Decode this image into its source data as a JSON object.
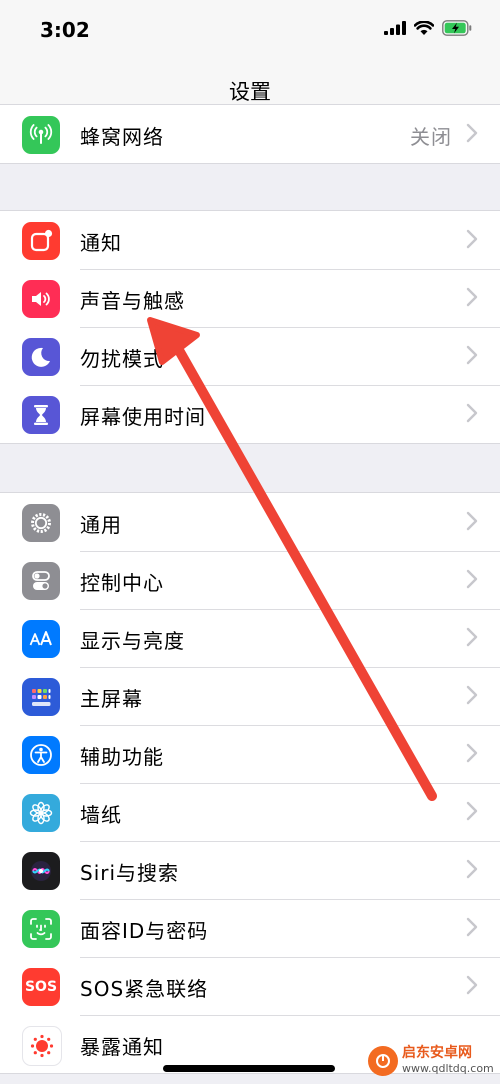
{
  "status": {
    "time": "3:02"
  },
  "nav": {
    "title": "设置"
  },
  "group_top": [
    {
      "label": "蜂窝网络",
      "value": "关闭",
      "icon": "cellular-icon",
      "color": "#34c759"
    }
  ],
  "group_a": [
    {
      "label": "通知",
      "icon": "notifications-icon",
      "color": "#ff3b30"
    },
    {
      "label": "声音与触感",
      "icon": "speaker-icon",
      "color": "#ff2d55"
    },
    {
      "label": "勿扰模式",
      "icon": "moon-icon",
      "color": "#5856d6"
    },
    {
      "label": "屏幕使用时间",
      "icon": "hourglass-icon",
      "color": "#5856d6"
    }
  ],
  "group_b": [
    {
      "label": "通用",
      "icon": "gear-icon",
      "color": "#8e8e93"
    },
    {
      "label": "控制中心",
      "icon": "toggles-icon",
      "color": "#8e8e93"
    },
    {
      "label": "显示与亮度",
      "icon": "text-size-icon",
      "color": "#007aff"
    },
    {
      "label": "主屏幕",
      "icon": "home-grid-icon",
      "color": "#2d5bd8"
    },
    {
      "label": "辅助功能",
      "icon": "accessibility-icon",
      "color": "#007aff"
    },
    {
      "label": "墙纸",
      "icon": "flower-icon",
      "color": "#34aadc"
    },
    {
      "label": "Siri与搜索",
      "icon": "siri-icon",
      "color": "#1c1c1e"
    },
    {
      "label": "面容ID与密码",
      "icon": "face-id-icon",
      "color": "#34c759"
    },
    {
      "label": "SOS紧急联络",
      "icon": "sos-icon",
      "color": "#ff3b30"
    },
    {
      "label": "暴露通知",
      "icon": "exposure-icon",
      "color": "#ffffff"
    }
  ],
  "watermark": {
    "name": "启东安卓网",
    "url": "www.qdltdq.com"
  },
  "colors": {
    "annotation_arrow": "#ef4335",
    "chevron": "#c7c7cc"
  }
}
